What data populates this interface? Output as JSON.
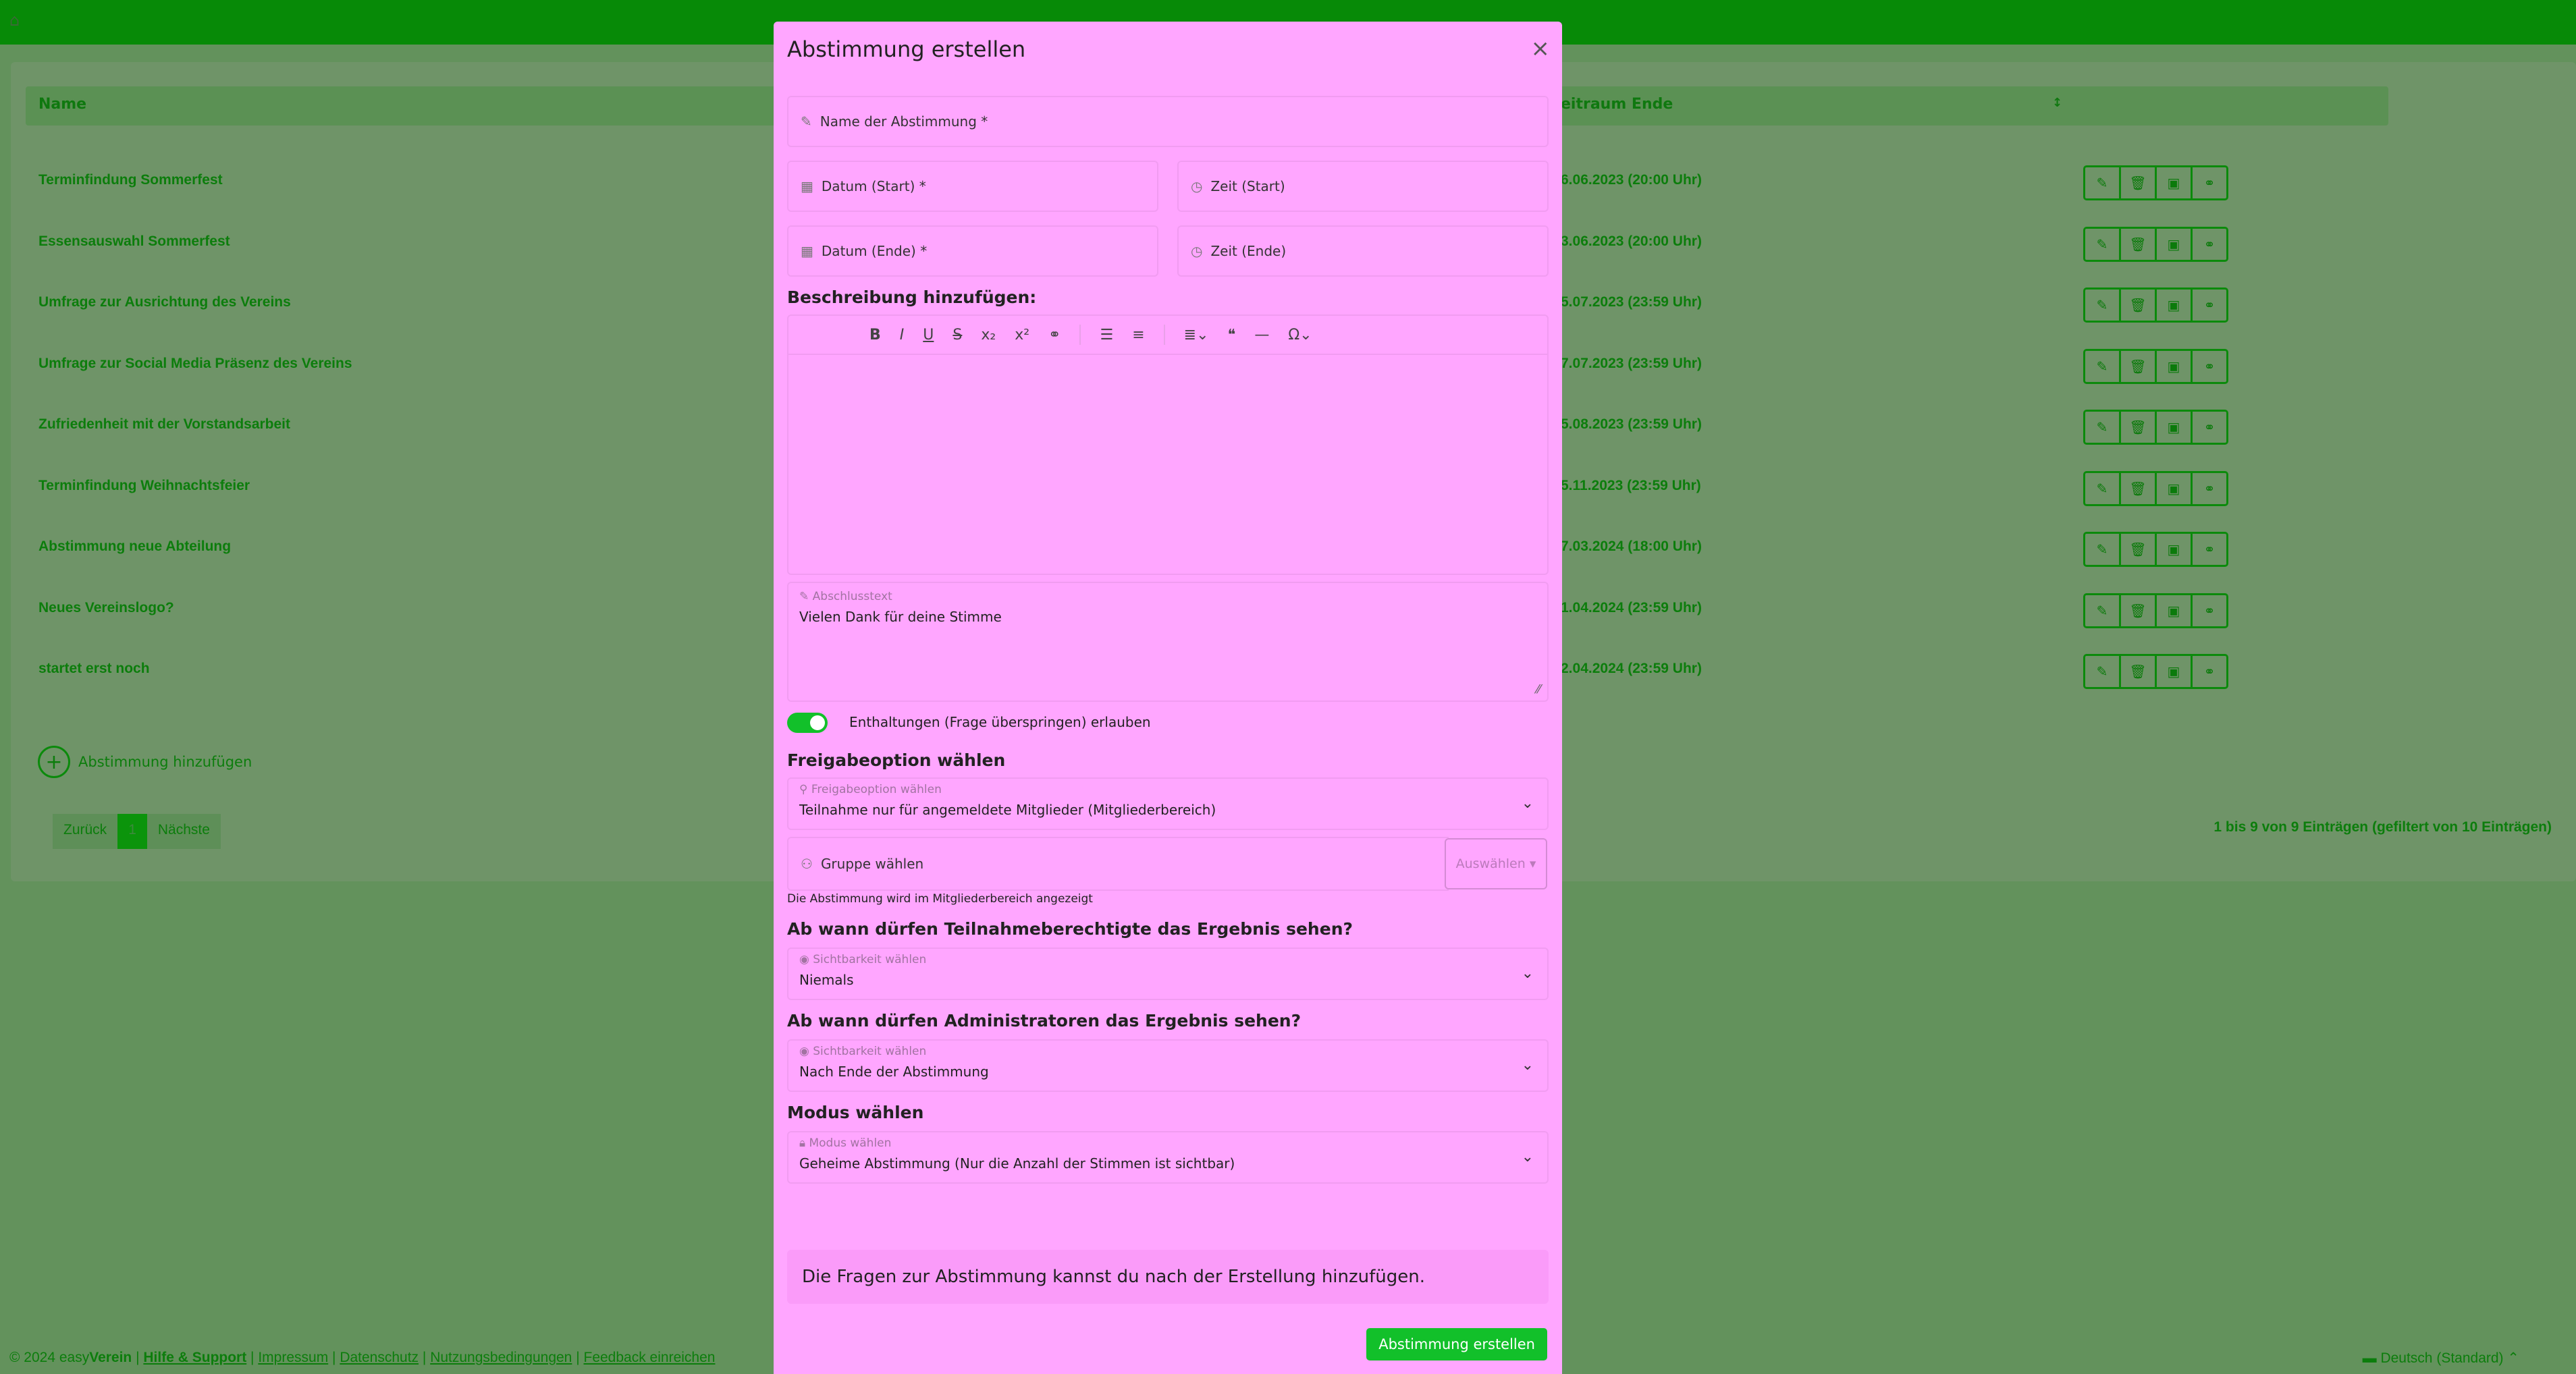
{
  "table": {
    "col_name": "Name",
    "col_end": "eitraum Ende",
    "rows": [
      {
        "name": "Terminfindung Sommerfest",
        "end": "6.06.2023 (20:00 Uhr)"
      },
      {
        "name": "Essensauswahl Sommerfest",
        "end": "3.06.2023 (20:00 Uhr)"
      },
      {
        "name": "Umfrage zur Ausrichtung des Vereins",
        "end": "5.07.2023 (23:59 Uhr)"
      },
      {
        "name": "Umfrage zur Social Media Präsenz des Vereins",
        "end": "7.07.2023 (23:59 Uhr)"
      },
      {
        "name": "Zufriedenheit mit der Vorstandsarbeit",
        "end": "5.08.2023 (23:59 Uhr)"
      },
      {
        "name": "Terminfindung Weihnachtsfeier",
        "end": "5.11.2023 (23:59 Uhr)"
      },
      {
        "name": "Abstimmung neue Abteilung",
        "end": "7.03.2024 (18:00 Uhr)"
      },
      {
        "name": "Neues Vereinslogo?",
        "end": "1.04.2024 (23:59 Uhr)"
      },
      {
        "name": "startet erst noch",
        "end": "2.04.2024 (23:59 Uhr)"
      }
    ],
    "add_label": "Abstimmung hinzufügen",
    "pager": {
      "prev": "Zurück",
      "current": "1",
      "next": "Nächste"
    },
    "info": "1 bis 9 von 9 Einträgen (gefiltert von 10 Einträgen)"
  },
  "footer": {
    "copyright": "© 2024 easy",
    "brand": "Verein",
    "links": [
      "Hilfe & Support",
      "Impressum",
      "Datenschutz",
      "Nutzungsbedingungen",
      "Feedback einreichen"
    ],
    "language": "Deutsch (Standard)"
  },
  "modal": {
    "title": "Abstimmung erstellen",
    "name_placeholder": "Name der Abstimmung *",
    "date_start": "Datum (Start) *",
    "time_start": "Zeit (Start)",
    "date_end": "Datum (Ende) *",
    "time_end": "Zeit (Ende)",
    "description_heading": "Beschreibung hinzufügen:",
    "closing_label": "Abschlusstext",
    "closing_value": "Vielen Dank für deine Stimme",
    "abstention_label": "Enthaltungen (Frage überspringen) erlauben",
    "release_heading": "Freigabeoption wählen",
    "release_label": "Freigabeoption wählen",
    "release_value": "Teilnahme nur für angemeldete Mitglieder (Mitgliederbereich)",
    "group_label": "Gruppe wählen",
    "group_button": "Auswählen",
    "group_hint": "Die Abstimmung wird im Mitgliederbereich angezeigt",
    "participants_heading": "Ab wann dürfen Teilnahmeberechtigte das Ergebnis sehen?",
    "visibility_label": "Sichtbarkeit wählen",
    "participants_value": "Niemals",
    "admins_heading": "Ab wann dürfen Administratoren das Ergebnis sehen?",
    "admins_value": "Nach Ende der Abstimmung",
    "mode_heading": "Modus wählen",
    "mode_label": "Modus wählen",
    "mode_value": "Geheime Abstimmung (Nur die Anzahl der Stimmen ist sichtbar)",
    "note": "Die Fragen zur Abstimmung kannst du nach der Erstellung hinzufügen.",
    "submit": "Abstimmung erstellen"
  },
  "colors": {
    "accent": "#12c02a",
    "modal_bg": "#ffa6ff",
    "topbar": "#078a07"
  }
}
